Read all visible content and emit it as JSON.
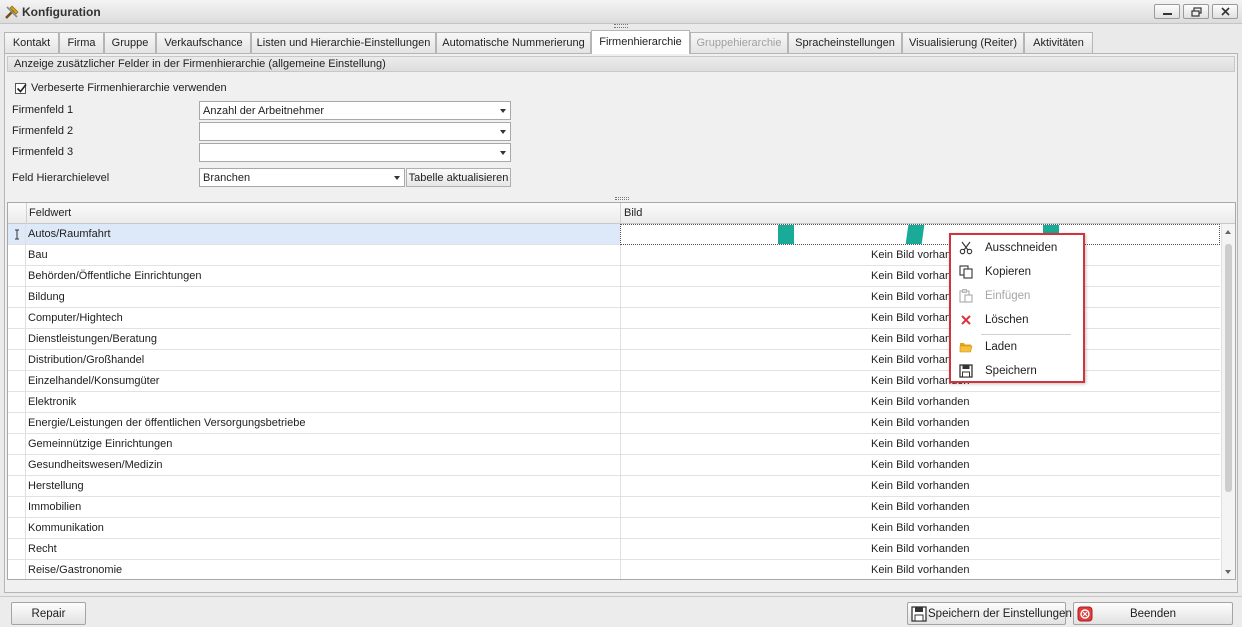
{
  "window": {
    "title": "Konfiguration"
  },
  "tabs": [
    {
      "label": "Kontakt"
    },
    {
      "label": "Firma"
    },
    {
      "label": "Gruppe"
    },
    {
      "label": "Verkaufschance"
    },
    {
      "label": "Listen und Hierarchie-Einstellungen"
    },
    {
      "label": "Automatische Nummerierung"
    },
    {
      "label": "Firmenhierarchie",
      "active": true
    },
    {
      "label": "Gruppehierarchie",
      "disabled": true
    },
    {
      "label": "Spracheinstellungen"
    },
    {
      "label": "Visualisierung (Reiter)"
    },
    {
      "label": "Aktivitäten"
    }
  ],
  "settings": {
    "group_title": "Anzeige zusätzlicher Felder in der Firmenhierarchie (allgemeine Einstellung)",
    "checkbox_label": "Verbeserte Firmenhierarchie verwenden",
    "checkbox_checked": true,
    "field1_label": "Firmenfeld 1",
    "field1_value": "Anzahl der Arbeitnehmer",
    "field2_label": "Firmenfeld 2",
    "field2_value": "",
    "field3_label": "Firmenfeld 3",
    "field3_value": "",
    "level_label": "Feld Hierarchielevel",
    "level_value": "Branchen",
    "refresh_button": "Tabelle aktualisieren"
  },
  "grid": {
    "columns": [
      "Feldwert",
      "Bild"
    ],
    "rows": [
      {
        "feldwert": "Autos/Raumfahrt",
        "bild": ""
      },
      {
        "feldwert": "Bau",
        "bild": "Kein Bild vorhanden"
      },
      {
        "feldwert": "Behörden/Öffentliche Einrichtungen",
        "bild": "Kein Bild vorhanden"
      },
      {
        "feldwert": "Bildung",
        "bild": "Kein Bild vorhanden"
      },
      {
        "feldwert": "Computer/Hightech",
        "bild": "Kein Bild vorhanden"
      },
      {
        "feldwert": "Dienstleistungen/Beratung",
        "bild": "Kein Bild vorhanden"
      },
      {
        "feldwert": "Distribution/Großhandel",
        "bild": "Kein Bild vorhanden"
      },
      {
        "feldwert": "Einzelhandel/Konsumgüter",
        "bild": "Kein Bild vorhanden"
      },
      {
        "feldwert": "Elektronik",
        "bild": "Kein Bild vorhanden"
      },
      {
        "feldwert": "Energie/Leistungen der öffentlichen Versorgungsbetriebe",
        "bild": "Kein Bild vorhanden"
      },
      {
        "feldwert": "Gemeinnützige Einrichtungen",
        "bild": "Kein Bild vorhanden"
      },
      {
        "feldwert": "Gesundheitswesen/Medizin",
        "bild": "Kein Bild vorhanden"
      },
      {
        "feldwert": "Herstellung",
        "bild": "Kein Bild vorhanden"
      },
      {
        "feldwert": "Immobilien",
        "bild": "Kein Bild vorhanden"
      },
      {
        "feldwert": "Kommunikation",
        "bild": "Kein Bild vorhanden"
      },
      {
        "feldwert": "Recht",
        "bild": "Kein Bild vorhanden"
      },
      {
        "feldwert": "Reise/Gastronomie",
        "bild": "Kein Bild vorhanden"
      }
    ]
  },
  "context_menu": {
    "items": [
      {
        "label": "Ausschneiden",
        "icon": "scissors-icon",
        "disabled": false
      },
      {
        "label": "Kopieren",
        "icon": "copy-icon",
        "disabled": false
      },
      {
        "label": "Einfügen",
        "icon": "paste-icon",
        "disabled": true
      },
      {
        "label": "Löschen",
        "icon": "delete-icon",
        "disabled": false
      },
      {
        "label": "Laden",
        "icon": "folder-open-icon",
        "disabled": false
      },
      {
        "label": "Speichern",
        "icon": "floppy-disk-icon",
        "disabled": false
      }
    ],
    "border_color": "#d3333b"
  },
  "footer": {
    "repair_button": "Repair",
    "save_button": "Speichern der Einstellungen",
    "exit_button": "Beenden"
  },
  "colors": {
    "teal_image": "#1aaa98",
    "selected_row": "#dde8f8"
  }
}
